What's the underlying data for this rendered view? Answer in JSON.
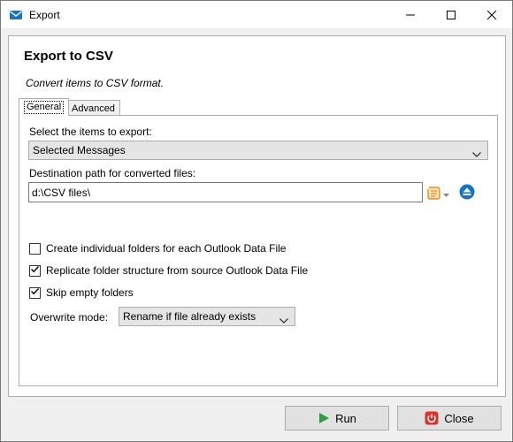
{
  "window": {
    "title": "Export"
  },
  "dialog": {
    "heading": "Export to CSV",
    "subheading": "Convert items to CSV format."
  },
  "tabs": [
    {
      "label": "General",
      "selected": true
    },
    {
      "label": "Advanced",
      "selected": false
    }
  ],
  "general": {
    "items_label": "Select the items to export:",
    "items_value": "Selected Messages",
    "dest_label": "Destination path for converted files:",
    "dest_value": "d:\\CSV files\\",
    "checkboxes": [
      {
        "label": "Create individual folders for each Outlook Data File",
        "checked": false
      },
      {
        "label": "Replicate folder structure from source Outlook Data File",
        "checked": true
      },
      {
        "label": "Skip empty folders",
        "checked": true
      }
    ],
    "overwrite_label": "Overwrite mode:",
    "overwrite_value": "Rename if file already exists"
  },
  "buttons": {
    "run": "Run",
    "close": "Close"
  },
  "colors": {
    "accent": "#0078d7",
    "run_green": "#2e9e3e",
    "close_red": "#d9342b",
    "browse_orange": "#e07b00",
    "eject_blue": "#1a73c0"
  },
  "icons": [
    "app-envelope-icon",
    "minimize-icon",
    "maximize-icon",
    "close-icon",
    "chevron-down-icon",
    "browse-folder-icon",
    "eject-icon",
    "play-icon",
    "power-icon",
    "checkmark-icon"
  ]
}
